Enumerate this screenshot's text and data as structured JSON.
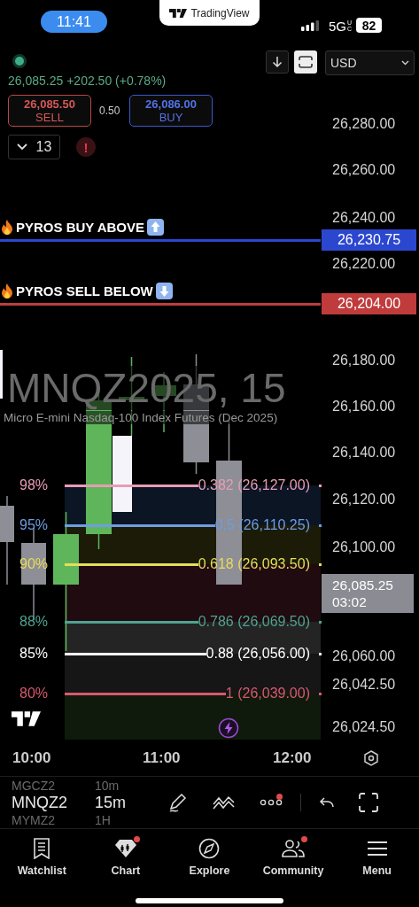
{
  "status_bar": {
    "time": "11:41",
    "island_app": "TradingView",
    "network": "5G",
    "network_badge": "UC",
    "battery": "82"
  },
  "legend": {
    "last": "26,085.25 +202.50 (+0.78%)",
    "sell": {
      "price": "26,085.50",
      "label": "SELL"
    },
    "spread": "0.50",
    "buy": {
      "price": "26,086.00",
      "label": "BUY"
    },
    "indicators": "13",
    "alert": "!"
  },
  "chart_toolbar": {
    "currency": "USD"
  },
  "watermark": {
    "symbol": "MNQZ2025, 15",
    "description": "Micro E-mini Nasdaq-100 Index Futures (Dec 2025)"
  },
  "price_axis": [
    "26,280.00",
    "26,260.00",
    "26,240.00",
    "26,220.00",
    "26,180.00",
    "26,160.00",
    "26,140.00",
    "26,120.00",
    "26,100.00",
    "26,060.00",
    "26,042.50",
    "26,024.50"
  ],
  "alert_lines": [
    {
      "label": "PYROS BUY ABOVE",
      "price": "26,230.75",
      "color": "#2c47cf",
      "kind": "up"
    },
    {
      "label": "PYROS SELL BELOW",
      "price": "26,204.00",
      "color": "#c03c3c",
      "kind": "down"
    }
  ],
  "fib_levels": [
    {
      "percent": "98%",
      "label": "0.382 (26,127.00)",
      "color": "#e79db4"
    },
    {
      "percent": "95%",
      "label": "0.5 (26,110.25)",
      "color": "#6f9de0"
    },
    {
      "percent": "90%",
      "label": "0.618 (26,093.50)",
      "color": "#e8dc5a"
    },
    {
      "percent": "88%",
      "label": "0.786 (26,069.50)",
      "color": "#4fa391"
    },
    {
      "percent": "85%",
      "label": "0.88 (26,056.00)",
      "color": "#ffffff"
    },
    {
      "percent": "80%",
      "label": "1 (26,039.00)",
      "color": "#d7596f"
    }
  ],
  "current_price": {
    "price": "26,085.25",
    "countdown": "03:02"
  },
  "time_axis": [
    "10:00",
    "11:00",
    "12:00"
  ],
  "symbol_picker": [
    {
      "symbol": "MGCZ2",
      "interval": "10m",
      "selected": false
    },
    {
      "symbol": "MNQZ2",
      "interval": "15m",
      "selected": true
    },
    {
      "symbol": "MYMZ2",
      "interval": "1H",
      "selected": false
    }
  ],
  "tools": [
    {
      "kind": "pen",
      "badge": false
    },
    {
      "kind": "patterns",
      "badge": false
    },
    {
      "kind": "more",
      "badge": true
    },
    {
      "kind": "undo",
      "badge": false
    },
    {
      "kind": "fullscreen",
      "badge": false
    }
  ],
  "nav": [
    {
      "label": "Watchlist",
      "kind": "watchlist",
      "badge": false
    },
    {
      "label": "Chart",
      "kind": "chart",
      "badge": true
    },
    {
      "label": "Explore",
      "kind": "explore",
      "badge": false
    },
    {
      "label": "Community",
      "kind": "community",
      "badge": true
    },
    {
      "label": "Menu",
      "kind": "menu",
      "badge": false
    }
  ]
}
